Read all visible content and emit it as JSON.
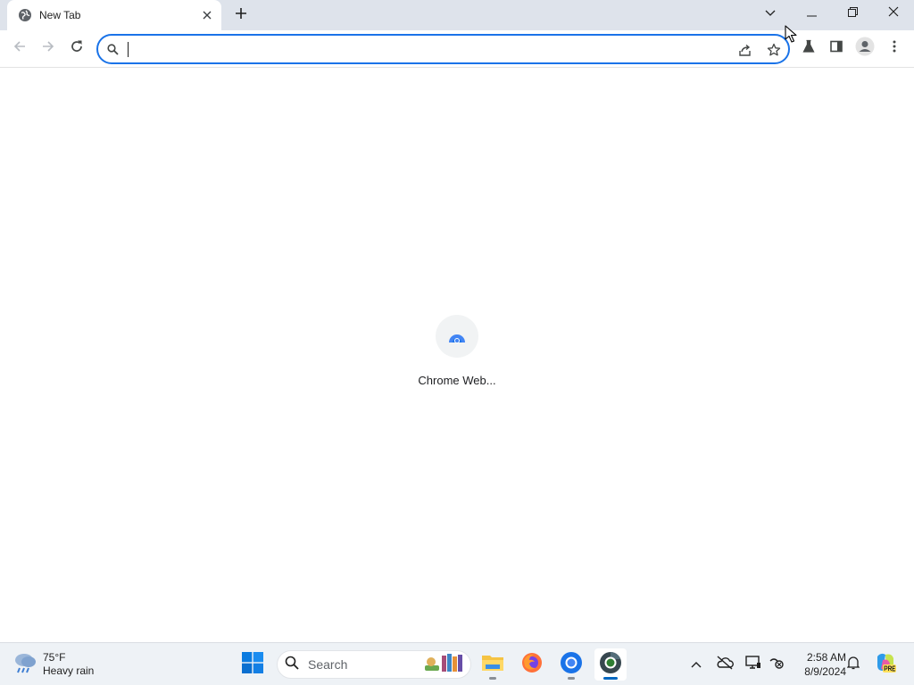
{
  "browser": {
    "tab": {
      "title": "New Tab",
      "favicon": "globe-icon",
      "close_icon": "close-icon"
    },
    "new_tab_icon": "plus-icon",
    "window_controls": [
      "chevron-down-icon",
      "minimize-icon",
      "restore-icon",
      "close-icon"
    ],
    "toolbar": {
      "back_icon": "arrow-left-icon",
      "forward_icon": "arrow-right-icon",
      "reload_icon": "reload-icon",
      "omnibox": {
        "value": "",
        "placeholder": "",
        "search_icon": "search-icon",
        "share_icon": "share-icon",
        "bookmark_icon": "star-icon"
      },
      "extensions_icon": "labs-flask-icon",
      "side_panel_icon": "side-panel-icon",
      "profile_icon": "profile-icon",
      "menu_icon": "kebab-menu-icon"
    }
  },
  "new_tab_page": {
    "shortcuts": [
      {
        "label": "Chrome Web...",
        "icon": "chrome-web-store-icon"
      }
    ]
  },
  "taskbar": {
    "weather": {
      "temp": "75°F",
      "condition": "Heavy rain",
      "icon": "rain-cloud-icon"
    },
    "start_icon": "windows-logo-icon",
    "search": {
      "label": "Search",
      "icon": "search-icon"
    },
    "apps": [
      {
        "name": "library-books-icon"
      },
      {
        "name": "file-explorer-icon"
      },
      {
        "name": "firefox-icon"
      },
      {
        "name": "chrome-icon"
      },
      {
        "name": "chrome-dev-icon",
        "active": true
      }
    ],
    "tray": [
      "chevron-up-icon",
      "onedrive-offline-icon",
      "display-network-icon",
      "settings-status-icon"
    ],
    "clock": {
      "time": "2:58 AM",
      "date": "8/9/2024"
    },
    "notifications_icon": "bell-icon",
    "copilot_icon": "copilot-pre-icon"
  },
  "colors": {
    "tab_strip": "#dee3eb",
    "omnibox_focus": "#1a73e8",
    "taskbar": "#eef2f6",
    "accent": "#0067c0"
  }
}
